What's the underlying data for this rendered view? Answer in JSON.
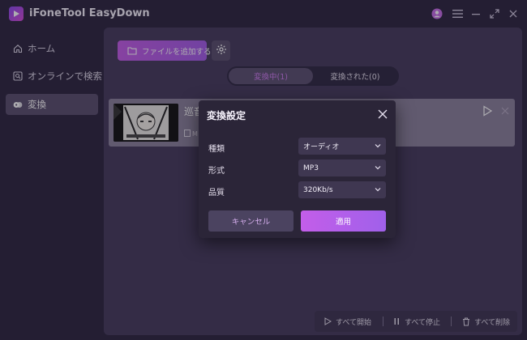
{
  "app": {
    "title": "iFoneTool EasyDown"
  },
  "titlebar": {
    "icons": [
      "account-icon",
      "menu-icon",
      "minimize-icon",
      "maximize-icon",
      "close-icon"
    ]
  },
  "sidebar": {
    "items": [
      {
        "label": "ホーム",
        "icon": "home-icon",
        "active": false
      },
      {
        "label": "オンラインで検索",
        "icon": "search-icon",
        "active": false
      },
      {
        "label": "変換",
        "icon": "convert-icon",
        "active": true
      }
    ]
  },
  "toolbar": {
    "add_file_label": "ファイルを追加する",
    "settings_icon": "gear-icon"
  },
  "tabs": [
    {
      "label": "変換中(1)",
      "active": true
    },
    {
      "label": "変換された(0)",
      "active": false
    }
  ],
  "task": {
    "title": "巡音",
    "meta": "M"
  },
  "bottom_bar": {
    "start_all": "すべて開始",
    "stop_all": "すべて停止",
    "delete_all": "すべて削除"
  },
  "dialog": {
    "title": "変換設定",
    "rows": [
      {
        "label": "種類",
        "value": "オーディオ"
      },
      {
        "label": "形式",
        "value": "MP3"
      },
      {
        "label": "品質",
        "value": "320Kb/s"
      }
    ],
    "cancel_label": "キャンセル",
    "apply_label": "適用"
  },
  "colors": {
    "accent": "#c45ce8",
    "accent_text": "#cf7df2",
    "background": "#2d2640",
    "panel": "#453b5c"
  }
}
